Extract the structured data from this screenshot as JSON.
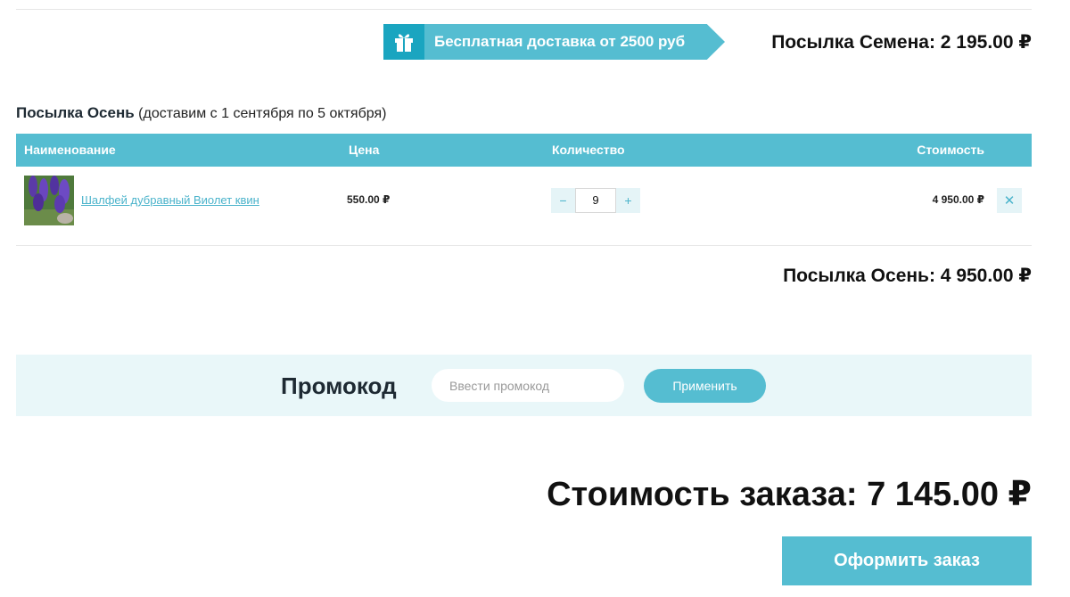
{
  "previous_parcel": {
    "free_shipping_text": "Бесплатная доставка от 2500 руб",
    "total_text": "Посылка Семена: 2 195.00 ₽"
  },
  "parcel": {
    "title": "Посылка Осень",
    "delivery_note": "(доставим с 1 сентября по 5 октября)",
    "columns": {
      "name": "Наименование",
      "price": "Цена",
      "quantity": "Количество",
      "cost": "Стоимость"
    },
    "items": [
      {
        "name": "Шалфей дубравный Виолет квин",
        "price": "550.00 ₽",
        "quantity": "9",
        "cost": "4 950.00 ₽"
      }
    ],
    "stepper": {
      "minus": "−",
      "plus": "+"
    },
    "remove_symbol": "✕",
    "total_text": "Посылка Осень: 4 950.00 ₽"
  },
  "promo": {
    "label": "Промокод",
    "placeholder": "Ввести промокод",
    "apply_label": "Применить"
  },
  "order": {
    "total_text": "Стоимость заказа: 7 145.00 ₽",
    "checkout_label": "Оформить заказ"
  },
  "colors": {
    "accent": "#55bdd1",
    "accent_dark": "#1aa5c0",
    "link": "#4ab3cb",
    "promo_bg": "#e9f7f9",
    "button_light_bg": "#e5f4f7"
  },
  "icons": {
    "banner": "gift-icon",
    "decrement": "minus-icon",
    "increment": "plus-icon",
    "remove": "close-icon"
  }
}
